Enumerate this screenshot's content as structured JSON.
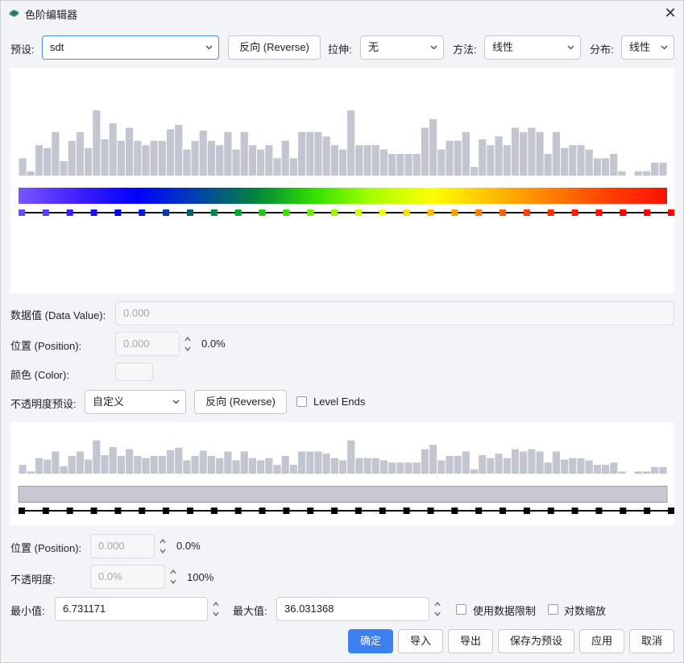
{
  "window": {
    "title": "色阶编辑器",
    "close_glyph": "✕"
  },
  "toolbar": {
    "preset_label": "预设:",
    "preset_value": "sdt",
    "reverse_label": "反向 (Reverse)",
    "stretch_label": "拉伸:",
    "stretch_value": "无",
    "method_label": "方法:",
    "method_value": "线性",
    "distribution_label": "分布:",
    "distribution_value": "线性"
  },
  "histogram": {
    "values": [
      0.24,
      0.06,
      0.42,
      0.38,
      0.6,
      0.2,
      0.48,
      0.6,
      0.38,
      0.9,
      0.5,
      0.72,
      0.48,
      0.66,
      0.48,
      0.42,
      0.48,
      0.48,
      0.64,
      0.7,
      0.36,
      0.48,
      0.62,
      0.48,
      0.42,
      0.6,
      0.36,
      0.6,
      0.42,
      0.36,
      0.42,
      0.24,
      0.48,
      0.24,
      0.6,
      0.6,
      0.6,
      0.54,
      0.42,
      0.36,
      0.9,
      0.42,
      0.42,
      0.42,
      0.36,
      0.3,
      0.3,
      0.3,
      0.3,
      0.66,
      0.78,
      0.36,
      0.48,
      0.48,
      0.6,
      0.12,
      0.5,
      0.42,
      0.54,
      0.42,
      0.66,
      0.6,
      0.66,
      0.6,
      0.3,
      0.6,
      0.38,
      0.42,
      0.42,
      0.36,
      0.24,
      0.24,
      0.3,
      0.06,
      0.0,
      0.06,
      0.06,
      0.18,
      0.18
    ],
    "bar_color": "#c2c6d0"
  },
  "color_stops": [
    "#6a4cff",
    "#5a3cff",
    "#3a1cff",
    "#1a0cff",
    "#0000ff",
    "#0018e0",
    "#0038b0",
    "#006070",
    "#008850",
    "#00aa30",
    "#20cc10",
    "#40e000",
    "#70f000",
    "#a0f800",
    "#d0ff00",
    "#f4ff00",
    "#ffe000",
    "#ffc000",
    "#ffa000",
    "#ff8000",
    "#ff6000",
    "#ff4000",
    "#ff3000",
    "#ff2000",
    "#ff1000",
    "#ff0000",
    "#ff0000",
    "#ff0000"
  ],
  "gradient": [
    "#7a55ff",
    "#4020ff",
    "#0000ff",
    "#0040b0",
    "#008040",
    "#30e000",
    "#a8ff00",
    "#ffff00",
    "#ffc000",
    "#ff8000",
    "#ff4000",
    "#ff1000"
  ],
  "data_value": {
    "label": "数据值 (Data Value):",
    "value": "0.000"
  },
  "position": {
    "label": "位置 (Position):",
    "value": "0.000",
    "percent": "0.0%"
  },
  "color": {
    "label": "颜色 (Color):"
  },
  "opacity_preset": {
    "label": "不透明度预设:",
    "value": "自定义",
    "reverse_label": "反向 (Reverse)",
    "level_ends_label": "Level Ends"
  },
  "opacity_bar_color": "#c6c9d2",
  "opacity_stops_count": 28,
  "position2": {
    "label": "位置 (Position):",
    "value": "0.000",
    "percent": "0.0%"
  },
  "opacity": {
    "label": "不透明度:",
    "value": "0.0%",
    "percent": "100%"
  },
  "range": {
    "min_label": "最小值:",
    "min_value": "6.731171",
    "max_label": "最大值:",
    "max_value": "36.031368",
    "use_data_label": "使用数据限制",
    "log_label": "对数缩放"
  },
  "footer": {
    "ok": "确定",
    "import": "导入",
    "export": "导出",
    "save_preset": "保存为预设",
    "apply": "应用",
    "cancel": "取消"
  }
}
